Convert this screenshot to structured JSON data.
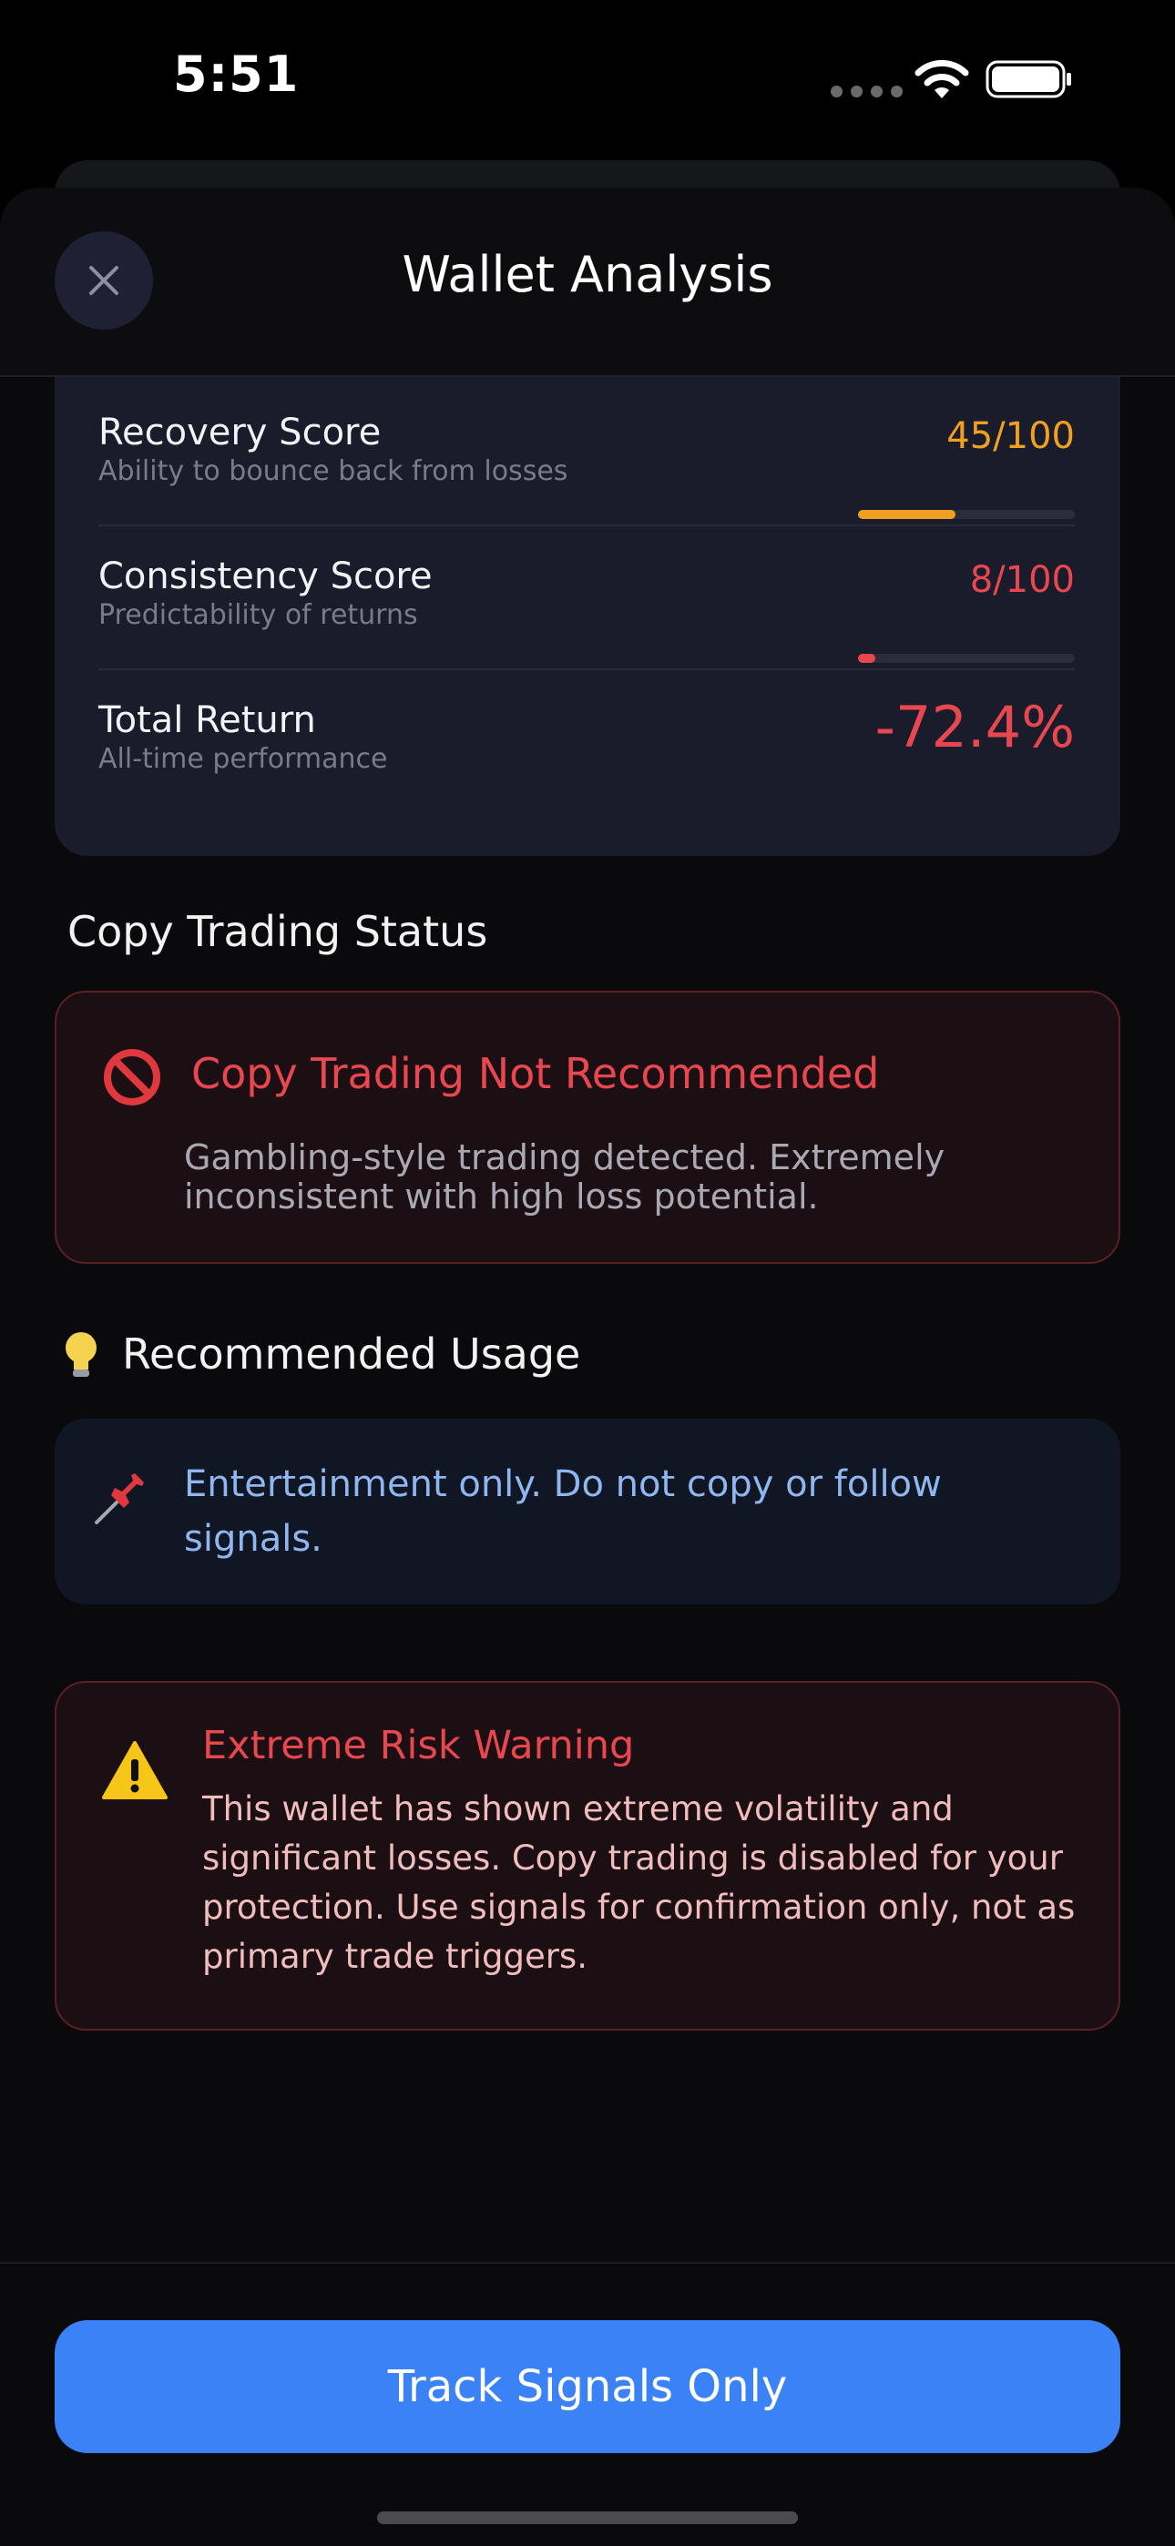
{
  "status_bar": {
    "time": "5:51"
  },
  "header": {
    "title": "Wallet Analysis"
  },
  "metrics": [
    {
      "label": "Recovery Score",
      "sub": "Ability to bounce back from losses",
      "value": "45/100",
      "progress": 0.45,
      "color": "#f0a020"
    },
    {
      "label": "Consistency Score",
      "sub": "Predictability of returns",
      "value": "8/100",
      "progress": 0.08,
      "color": "#e9474f"
    },
    {
      "label": "Total Return",
      "sub": "All-time performance",
      "value": "-72.4%",
      "color": "#e9474f"
    }
  ],
  "copy_trading": {
    "section_title": "Copy Trading Status",
    "status_title": "Copy Trading Not Recommended",
    "status_text": "Gambling-style trading detected. Extremely inconsistent with high loss potential.",
    "icon": "prohibited-icon"
  },
  "usage": {
    "section_title": "Recommended Usage",
    "icon": "lightbulb-icon",
    "text": "Entertainment only. Do not copy or follow signals.",
    "item_icon": "pushpin-icon"
  },
  "warning": {
    "title": "Extreme Risk Warning",
    "text": "This wallet has shown extreme volatility and significant losses. Copy trading is disabled for your protection. Use signals for confirmation only, not as primary trade triggers.",
    "icon": "warning-icon"
  },
  "cta": {
    "label": "Track Signals Only"
  }
}
